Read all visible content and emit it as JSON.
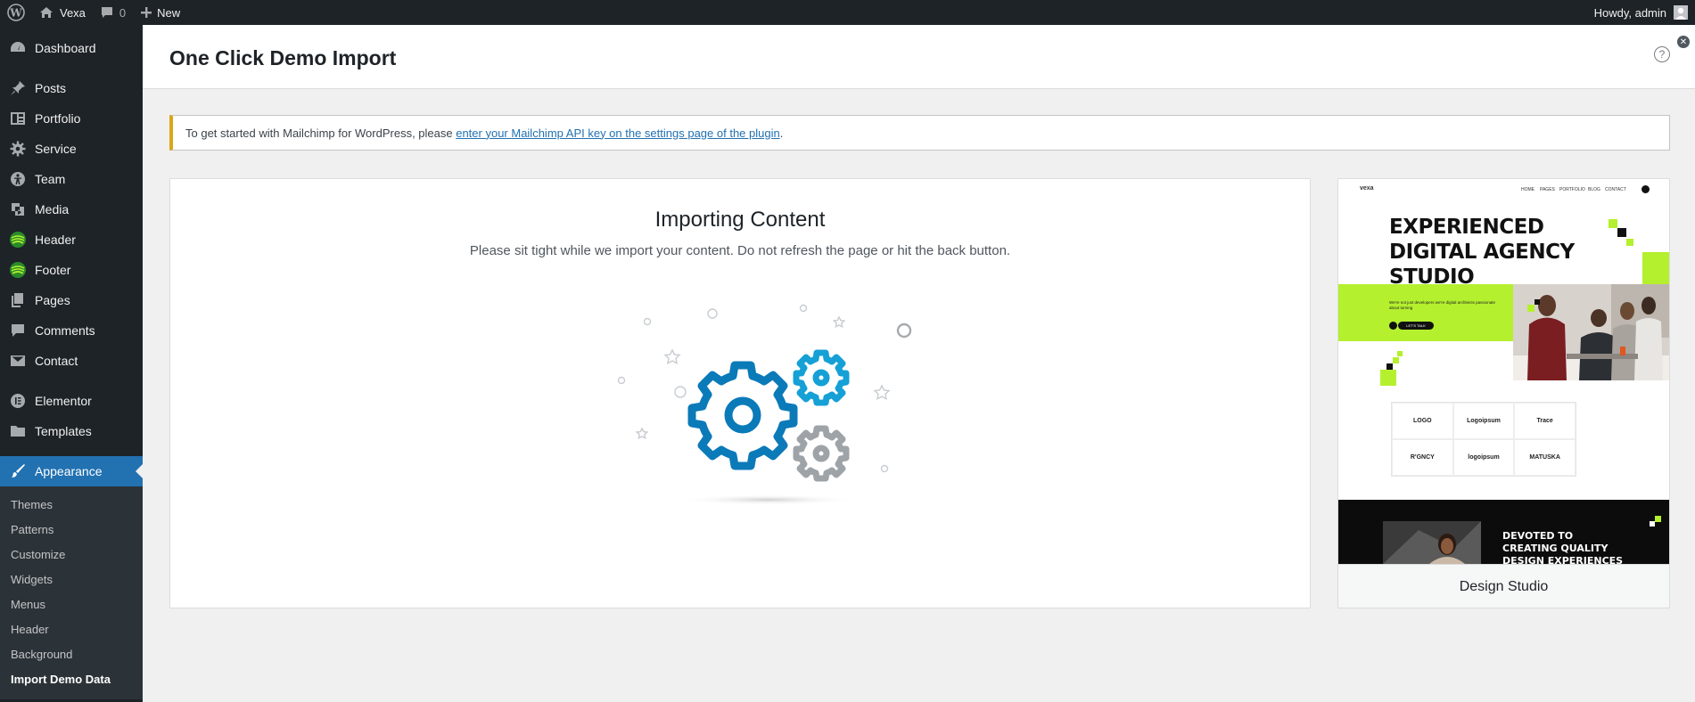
{
  "adminbar": {
    "site_name": "Vexa",
    "comments_count": "0",
    "new_label": "New",
    "howdy": "Howdy, admin"
  },
  "sidebar": {
    "items": [
      {
        "label": "Dashboard",
        "icon": "dashboard-icon"
      },
      {
        "label": "Posts",
        "icon": "pin-icon"
      },
      {
        "label": "Portfolio",
        "icon": "portfolio-icon"
      },
      {
        "label": "Service",
        "icon": "gear-icon"
      },
      {
        "label": "Team",
        "icon": "person-icon"
      },
      {
        "label": "Media",
        "icon": "media-icon"
      },
      {
        "label": "Header",
        "icon": "spiral-icon"
      },
      {
        "label": "Footer",
        "icon": "spiral-icon"
      },
      {
        "label": "Pages",
        "icon": "pages-icon"
      },
      {
        "label": "Comments",
        "icon": "comment-icon"
      },
      {
        "label": "Contact",
        "icon": "mail-icon"
      },
      {
        "label": "Elementor",
        "icon": "elementor-icon"
      },
      {
        "label": "Templates",
        "icon": "folder-icon"
      },
      {
        "label": "Appearance",
        "icon": "brush-icon"
      }
    ],
    "submenu": [
      "Themes",
      "Patterns",
      "Customize",
      "Widgets",
      "Menus",
      "Header",
      "Background",
      "Import Demo Data"
    ]
  },
  "page": {
    "title": "One Click Demo Import"
  },
  "notice": {
    "text": "To get started with Mailchimp for WordPress, please ",
    "link": "enter your Mailchimp API key on the settings page of the plugin",
    "suffix": "."
  },
  "importing": {
    "title": "Importing Content",
    "text": "Please sit tight while we import your content. Do not refresh the page or hit the back button."
  },
  "preview": {
    "nav_logo": "vexa",
    "nav_links": [
      "HOME",
      "PAGES",
      "PORTFOLIO",
      "BLOG",
      "CONTACT"
    ],
    "hero_lines": [
      "EXPERIENCED",
      "DIGITAL AGENCY",
      "STUDIO"
    ],
    "hero_sub": "We're not just developers we're digital architects passionate about turning",
    "hero_btn": "LET'S TALK",
    "logos": [
      "LOGO",
      "Logoipsum",
      "Trace",
      "R'GNCY",
      "logoipsum",
      "MATUSKA"
    ],
    "dark_lines": [
      "DEVOTED TO",
      "CREATING QUALITY",
      "DESIGN EXPERIENCES"
    ],
    "caption": "Design Studio"
  },
  "colors": {
    "admin_dark": "#1d2327",
    "accent": "#2271b1",
    "notice_warning": "#dba617",
    "lime": "#b4f02e",
    "gear_blue": "#0b7ab8",
    "gear_cyan": "#15a0d6",
    "gear_grey": "#9ea3a8"
  }
}
